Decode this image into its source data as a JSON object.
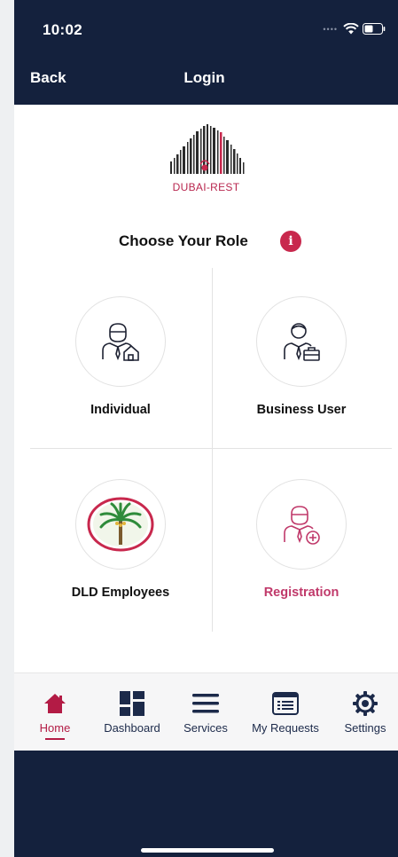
{
  "status_bar": {
    "time": "10:02"
  },
  "nav": {
    "back_label": "Back",
    "title": "Login"
  },
  "logo": {
    "text": "DUBAI-REST"
  },
  "heading": {
    "title": "Choose Your Role",
    "info_icon": "i"
  },
  "roles": [
    {
      "label": "Individual",
      "icon": "person-house-icon"
    },
    {
      "label": "Business User",
      "icon": "businessman-briefcase-icon"
    },
    {
      "label": "DLD Employees",
      "icon": "palm-tree-emblem-icon"
    },
    {
      "label": "Registration",
      "icon": "person-add-icon"
    }
  ],
  "tabs": [
    {
      "label": "Home",
      "icon": "home-icon",
      "active": true
    },
    {
      "label": "Dashboard",
      "icon": "dashboard-grid-icon"
    },
    {
      "label": "Services",
      "icon": "menu-lines-icon"
    },
    {
      "label": "My Requests",
      "icon": "list-card-icon"
    },
    {
      "label": "Settings",
      "icon": "gear-icon"
    }
  ],
  "colors": {
    "navy": "#14213d",
    "accent": "#b31b45",
    "info_red": "#c8284d"
  }
}
